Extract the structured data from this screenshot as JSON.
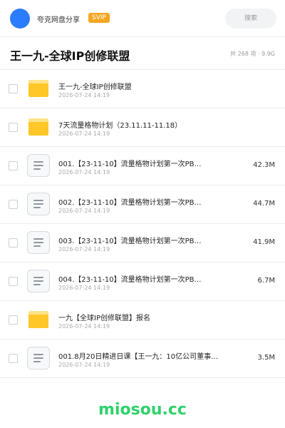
{
  "header": {
    "username": "夸克网盘分享",
    "vip_badge": "SVIP",
    "search_placeholder": "搜索"
  },
  "title_bar": {
    "title": "王一九-全球IP创修联盟",
    "meta": "共 268 项 · 9.9G"
  },
  "files": [
    {
      "type": "folder",
      "name": "王一九-全球IP创修联盟",
      "date": "2026-07-24 14:19",
      "size": ""
    },
    {
      "type": "folder",
      "name": "7天流量格物计划（23.11.11-11.18）",
      "date": "2026-07-24 14:19",
      "size": ""
    },
    {
      "type": "doc",
      "name": "001.【23-11-10】流量格物计划第一次PB…",
      "date": "2026-07-24 14:19",
      "size": "42.3M"
    },
    {
      "type": "doc",
      "name": "002.【23-11-10】流量格物计划第一次PB…",
      "date": "2026-07-24 14:19",
      "size": "44.7M"
    },
    {
      "type": "doc",
      "name": "003.【23-11-10】流量格物计划第一次PB…",
      "date": "2026-07-24 14:19",
      "size": "41.9M"
    },
    {
      "type": "doc",
      "name": "004.【23-11-10】流量格物计划第一次PB…",
      "date": "2026-07-24 14:19",
      "size": "6.7M"
    },
    {
      "type": "folder",
      "name": "一九【全球IP创修联盟】报名",
      "date": "2026-07-24 14:19",
      "size": ""
    },
    {
      "type": "doc",
      "name": "001.8月20日精进日课【王一九：10亿公司董事…",
      "date": "2026-07-24 14:19",
      "size": "3.5M"
    }
  ],
  "watermark": "miosou.cc"
}
